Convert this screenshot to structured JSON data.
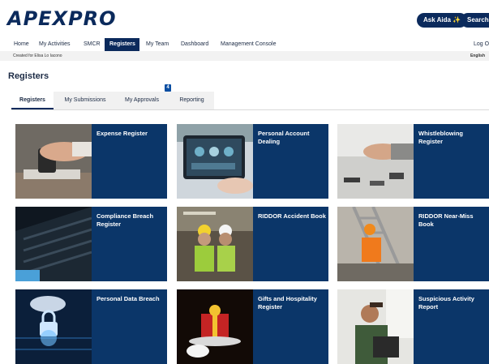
{
  "header": {
    "logo": "APEXPRO",
    "ask_button": "Ask Aida ✨",
    "search_button": "Search Q"
  },
  "nav": {
    "items": [
      "Home",
      "My Activities",
      "SMCR",
      "Registers",
      "My Team",
      "Dashboard",
      "Management Console"
    ],
    "logout": "Log O"
  },
  "subbar": {
    "created_for": "Created for Elisa Lo Iacono",
    "language": "English"
  },
  "page": {
    "title": "Registers"
  },
  "tabs": {
    "items": [
      "Registers",
      "My Submissions",
      "My Approvals",
      "Reporting"
    ],
    "approvals_badge": "4"
  },
  "cards": [
    {
      "label": "Expense Register",
      "image": "hand-on-stamp"
    },
    {
      "label": "Personal Account Dealing",
      "image": "tablet-trading-dashboard"
    },
    {
      "label": "Whistleblowing Register",
      "image": "hand-at-desk"
    },
    {
      "label": "Compliance Breach Register",
      "image": "laptop-keyboard"
    },
    {
      "label": "RIDDOR Accident Book",
      "image": "workers-in-hard-hats"
    },
    {
      "label": "RIDDOR Near-Miss Book",
      "image": "worker-on-ladder"
    },
    {
      "label": "Personal Data Breach",
      "image": "hand-digital-padlock"
    },
    {
      "label": "Gifts and Hospitality Register",
      "image": "gift-on-tray"
    },
    {
      "label": "Suspicious Activity Report",
      "image": "man-at-laptop"
    }
  ],
  "colors": {
    "brand_navy": "#0b2a5c",
    "card_navy": "#0b3669",
    "badge_blue": "#0b4ea2"
  }
}
